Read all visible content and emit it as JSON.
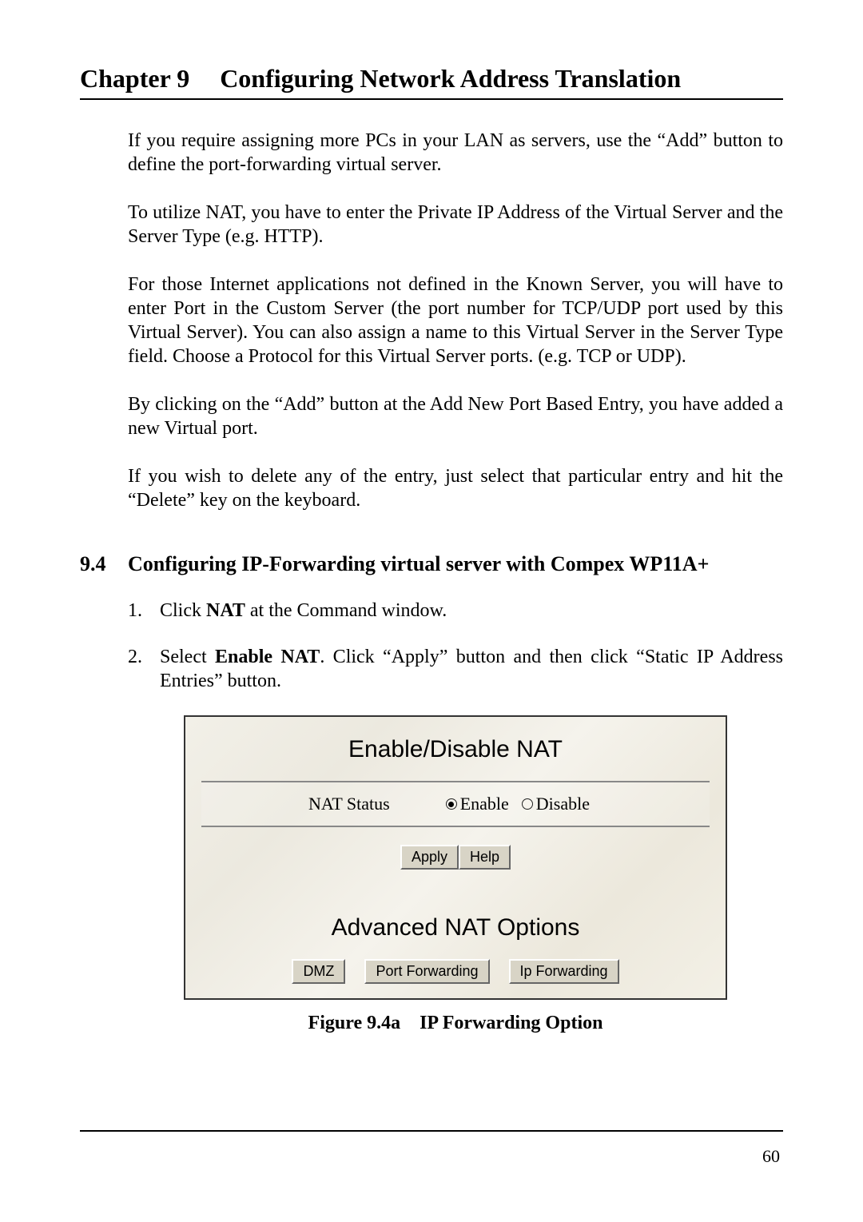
{
  "chapter": {
    "num": "Chapter 9",
    "title": "Configuring Network Address Translation"
  },
  "paragraphs": {
    "p1": "If you require assigning more PCs in your LAN as servers, use the “Add” button to define the port-forwarding virtual server.",
    "p2": "To utilize NAT, you have to enter the Private IP Address of the Virtual Server and the Server Type (e.g. HTTP).",
    "p3": "For those Internet applications not defined in the Known Server, you will have to enter Port in the Custom Server (the port number for TCP/UDP port used by this Virtual Server). You can also assign a name to this Virtual Server in the Server Type field. Choose a Protocol for this Virtual Server ports. (e.g. TCP or UDP).",
    "p4": "By clicking on the “Add” button at the Add New Port Based Entry, you have added a new Virtual port.",
    "p5": "If you wish to delete any of the entry, just select that particular entry and hit the “Delete” key on the keyboard."
  },
  "section": {
    "num": "9.4",
    "title": "Configuring IP-Forwarding virtual server with Compex WP11A+"
  },
  "steps": {
    "s1_pre": "Click ",
    "s1_bold": "NAT",
    "s1_post": " at the Command window.",
    "s2_pre": "Select ",
    "s2_bold": "Enable NAT",
    "s2_post": ". Click “Apply” button and then click “Static IP Address Entries” button."
  },
  "figure": {
    "title1": "Enable/Disable NAT",
    "row_label": "NAT Status",
    "enable": "Enable",
    "disable": "Disable",
    "apply": "Apply",
    "help": "Help",
    "title2": "Advanced NAT Options",
    "dmz": "DMZ",
    "pf": "Port Forwarding",
    "ipf": "Ip Forwarding",
    "caption_a": "Figure 9.4a",
    "caption_b": "IP Forwarding Option"
  },
  "page_number": "60"
}
